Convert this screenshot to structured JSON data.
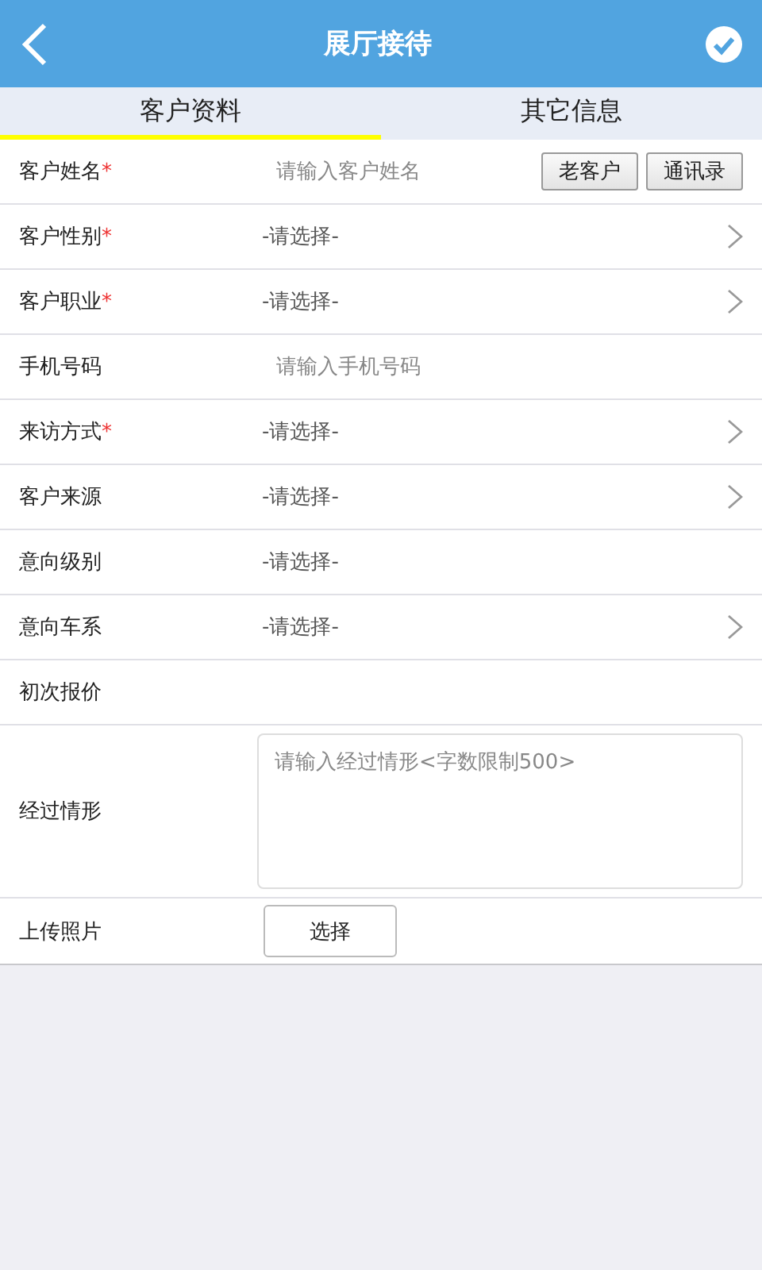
{
  "header": {
    "title": "展厅接待"
  },
  "tabs": [
    {
      "label": "客户资料",
      "selected": true
    },
    {
      "label": "其它信息",
      "selected": false
    }
  ],
  "rows": [
    {
      "kind": "input",
      "label": "客户姓名",
      "required_mark": "*",
      "placeholder": "请输入客户姓名",
      "buttons": [
        "老客户",
        "通讯录"
      ]
    },
    {
      "kind": "select",
      "label": "客户性别",
      "required_mark": "*",
      "value": "-请选择-",
      "chevron": true
    },
    {
      "kind": "select",
      "label": "客户职业",
      "required_mark": "*",
      "value": "-请选择-",
      "chevron": true
    },
    {
      "kind": "input",
      "label": "手机号码",
      "placeholder": "请输入手机号码"
    },
    {
      "kind": "select",
      "label": "来访方式",
      "required_mark": "*",
      "value": "-请选择-",
      "chevron": true
    },
    {
      "kind": "select",
      "label": "客户来源",
      "value": "-请选择-",
      "chevron": true
    },
    {
      "kind": "select",
      "label": "意向级别",
      "value": "-请选择-",
      "chevron": false
    },
    {
      "kind": "select",
      "label": "意向车系",
      "value": "-请选择-",
      "chevron": true
    },
    {
      "kind": "input",
      "label": "初次报价"
    },
    {
      "kind": "textarea",
      "label": "经过情形",
      "placeholder": "请输入经过情形<字数限制500>"
    },
    {
      "kind": "upload",
      "label": "上传照片",
      "button": "选择"
    }
  ]
}
